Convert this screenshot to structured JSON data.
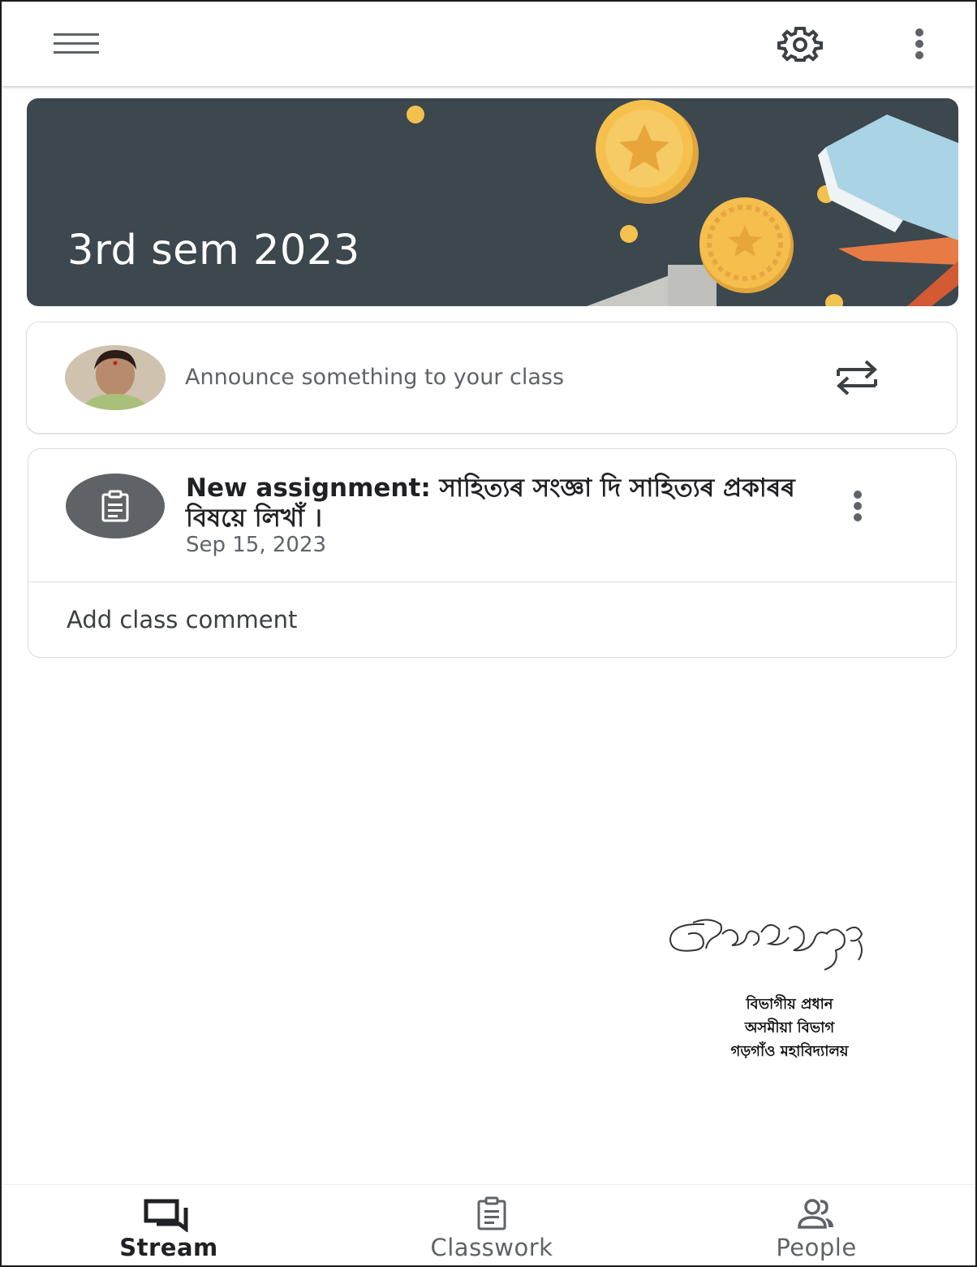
{
  "top_bar": {
    "menu_icon": "hamburger-menu-icon",
    "settings_icon": "gear-icon",
    "more_icon": "more-vertical-icon"
  },
  "banner": {
    "class_name": "3rd sem 2023",
    "background_color": "#3c474e",
    "theme": "medals"
  },
  "announce": {
    "placeholder": "Announce something to your class",
    "repost_icon": "repost-icon"
  },
  "stream_post": {
    "title": "New assignment: সাহিত্যৰ সংজ্ঞা দি সাহিত্যৰ প্ৰকাৰৰ বিষয়ে লিখাঁ ।",
    "date": "Sep 15, 2023",
    "icon": "assignment-icon",
    "comment_label": "Add class comment"
  },
  "stamp": {
    "line1": "বিভাগীয় প্ৰধান",
    "line2": "অসমীয়া বিভাগ",
    "line3": "গড়গাঁও মহাবিদ্যালয়"
  },
  "bottom_nav": {
    "items": [
      {
        "label": "Stream",
        "icon": "stream-icon",
        "active": true
      },
      {
        "label": "Classwork",
        "icon": "classwork-icon",
        "active": false
      },
      {
        "label": "People",
        "icon": "people-icon",
        "active": false
      }
    ]
  },
  "colors": {
    "text_primary": "#202124",
    "text_secondary": "#5f6368",
    "border": "#dadce0",
    "medal_gold": "#f2b84b"
  }
}
